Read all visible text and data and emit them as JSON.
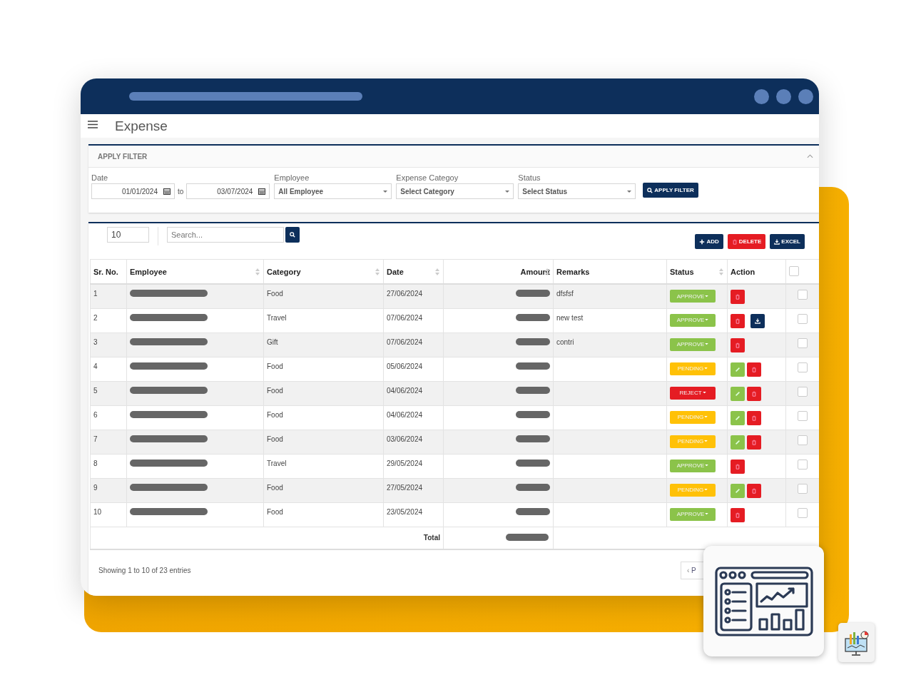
{
  "window": {
    "title": "Expense"
  },
  "filter": {
    "title": "APPLY FILTER",
    "expanded": true,
    "date_label": "Date",
    "date_from": "01/01/2024",
    "to": "to",
    "date_to": "03/07/2024",
    "employee_label": "Employee",
    "employee": "All Employee",
    "category_label": "Expense Categoy",
    "category": "Select Category",
    "status_label": "Status",
    "status": "Select Status",
    "apply": "APPLY FILTER"
  },
  "table_controls": {
    "page_size": "10",
    "search_placeholder": "Search...",
    "buttons": [
      {
        "label": "ADD",
        "kind": "add"
      },
      {
        "label": "DELETE",
        "kind": "delete"
      },
      {
        "label": "EXCEL",
        "kind": "excel"
      }
    ]
  },
  "table": {
    "columns": [
      {
        "label": "Sr. No.",
        "sortable": false
      },
      {
        "label": "Employee",
        "sortable": true
      },
      {
        "label": "Category",
        "sortable": true
      },
      {
        "label": "Date",
        "sortable": true
      },
      {
        "label": "Amount",
        "sortable": true
      },
      {
        "label": "Remarks",
        "sortable": false
      },
      {
        "label": "Status",
        "sortable": true
      },
      {
        "label": "Action",
        "sortable": false
      }
    ],
    "select_all_checked": false,
    "rows": [
      {
        "sr": "1",
        "category": "Food",
        "date": "27/06/2024",
        "remarks": "dfsfsf",
        "status": {
          "label": "APPROVE",
          "kind": "approve"
        },
        "actions": [
          {
            "kind": "delete"
          }
        ],
        "checked": false
      },
      {
        "sr": "2",
        "category": "Travel",
        "date": "07/06/2024",
        "remarks": "new test",
        "status": {
          "label": "APPROVE",
          "kind": "approve"
        },
        "actions": [
          {
            "kind": "delete"
          },
          {
            "kind": "download"
          }
        ],
        "checked": false
      },
      {
        "sr": "3",
        "category": "Gift",
        "date": "07/06/2024",
        "remarks": "contri",
        "status": {
          "label": "APPROVE",
          "kind": "approve"
        },
        "actions": [
          {
            "kind": "delete"
          }
        ],
        "checked": false
      },
      {
        "sr": "4",
        "category": "Food",
        "date": "05/06/2024",
        "status": {
          "label": "PENDING",
          "kind": "pending"
        },
        "actions": [
          {
            "kind": "edit"
          },
          {
            "kind": "delete"
          }
        ],
        "checked": false
      },
      {
        "sr": "5",
        "category": "Food",
        "date": "04/06/2024",
        "status": {
          "label": "REJECT",
          "kind": "reject"
        },
        "actions": [
          {
            "kind": "edit"
          },
          {
            "kind": "delete"
          }
        ],
        "checked": false
      },
      {
        "sr": "6",
        "category": "Food",
        "date": "04/06/2024",
        "status": {
          "label": "PENDING",
          "kind": "pending"
        },
        "actions": [
          {
            "kind": "edit"
          },
          {
            "kind": "delete"
          }
        ],
        "checked": false
      },
      {
        "sr": "7",
        "category": "Food",
        "date": "03/06/2024",
        "status": {
          "label": "PENDING",
          "kind": "pending"
        },
        "actions": [
          {
            "kind": "edit"
          },
          {
            "kind": "delete"
          }
        ],
        "checked": false
      },
      {
        "sr": "8",
        "category": "Travel",
        "date": "29/05/2024",
        "status": {
          "label": "APPROVE",
          "kind": "approve"
        },
        "actions": [
          {
            "kind": "delete"
          }
        ],
        "checked": false
      },
      {
        "sr": "9",
        "category": "Food",
        "date": "27/05/2024",
        "status": {
          "label": "PENDING",
          "kind": "pending"
        },
        "actions": [
          {
            "kind": "edit"
          },
          {
            "kind": "delete"
          }
        ],
        "checked": false
      },
      {
        "sr": "10",
        "category": "Food",
        "date": "23/05/2024",
        "status": {
          "label": "APPROVE",
          "kind": "approve"
        },
        "actions": [
          {
            "kind": "delete"
          }
        ],
        "checked": false
      }
    ],
    "total_label": "Total"
  },
  "footer": {
    "info": "Showing 1 to 10 of 23 entries",
    "prev": "‹",
    "page": "P"
  }
}
